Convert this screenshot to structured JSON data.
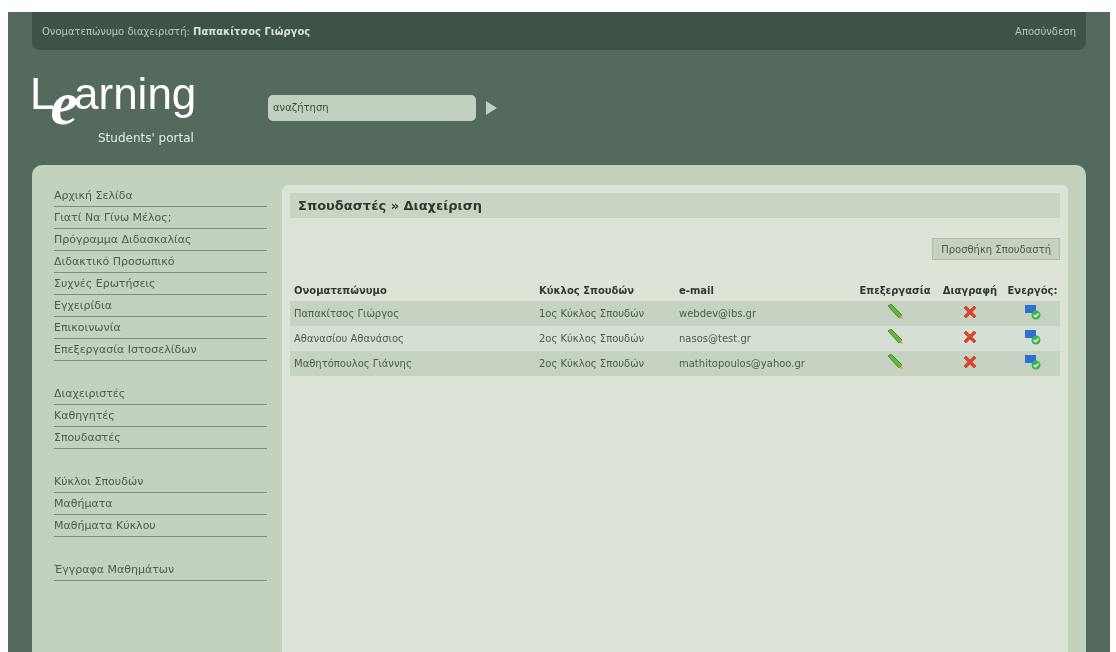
{
  "top_bar": {
    "user_label": "Ονοματεπώνυμο διαχειριστή:",
    "user_name": "Παπακίτσος Γιώργος",
    "logout": "Αποσύνδεση"
  },
  "logo": {
    "first": "L",
    "big": "e",
    "rest": "arning",
    "tagline": "Students' portal"
  },
  "search": {
    "placeholder": "αναζήτηση"
  },
  "sidebar": {
    "groups": [
      {
        "items": [
          "Αρχική Σελίδα",
          "Γιατί Να Γίνω Μέλος;",
          "Πρόγραμμα Διδασκαλίας",
          "Διδακτικό Προσωπικό",
          "Συχνές Ερωτήσεις",
          "Εγχειρίδια",
          "Επικοινωνία",
          "Επεξεργασία Ιστοσελίδων"
        ]
      },
      {
        "items": [
          "Διαχειριστές",
          "Καθηγητές",
          "Σπουδαστές"
        ]
      },
      {
        "items": [
          "Κύκλοι Σπουδών",
          "Μαθήματα",
          "Μαθήματα Κύκλου"
        ]
      },
      {
        "items": [
          "Έγγραφα Μαθημάτων"
        ]
      }
    ]
  },
  "main": {
    "title": "Σπουδαστές » Διαχείριση",
    "add_button": "Προσθήκη Σπουδαστή",
    "table": {
      "columns": [
        "Ονοματεπώνυμο",
        "Κύκλος Σπουδών",
        "e-mail",
        "Επεξεργασία",
        "Διαγραφή",
        "Ενεργός:"
      ],
      "rows": [
        {
          "name": "Παπακίτσος Γιώργος",
          "cycle": "1ος Κύκλος Σπουδών",
          "email": "webdev@ibs.gr"
        },
        {
          "name": "Αθανασίου Αθανάσιος",
          "cycle": "2ος Κύκλος Σπουδών",
          "email": "nasos@test.gr"
        },
        {
          "name": "Μαθητόπουλος Γιάννης",
          "cycle": "2ος Κύκλος Σπουδών",
          "email": "mathitopoulos@yahoo.gr"
        }
      ]
    }
  }
}
